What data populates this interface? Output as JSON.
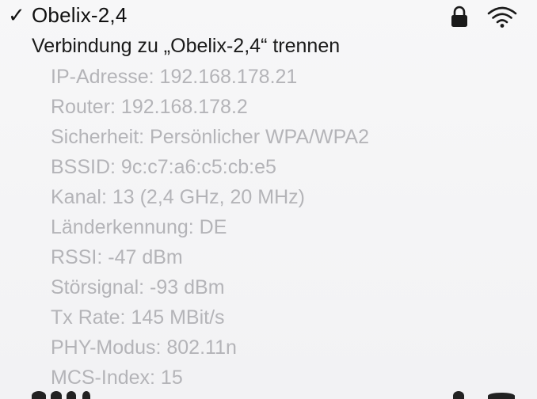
{
  "network": {
    "checkmark": "✓",
    "name": "Obelix-2,4",
    "lock_icon": "lock-icon",
    "wifi_icon": "wifi-icon"
  },
  "disconnect_label": "Verbindung zu „Obelix-2,4“ trennen",
  "details": [
    "IP-Adresse: 192.168.178.21",
    "Router: 192.168.178.2",
    "Sicherheit: Persönlicher WPA/WPA2",
    "BSSID: 9c:c7:a6:c5:cb:e5",
    "Kanal: 13 (2,4 GHz, 20 MHz)",
    "Länderkennung: DE",
    "RSSI: -47 dBm",
    "Störsignal: -93 dBm",
    "Tx Rate: 145 MBit/s",
    "PHY-Modus: 802.11n",
    "MCS-Index: 15"
  ]
}
